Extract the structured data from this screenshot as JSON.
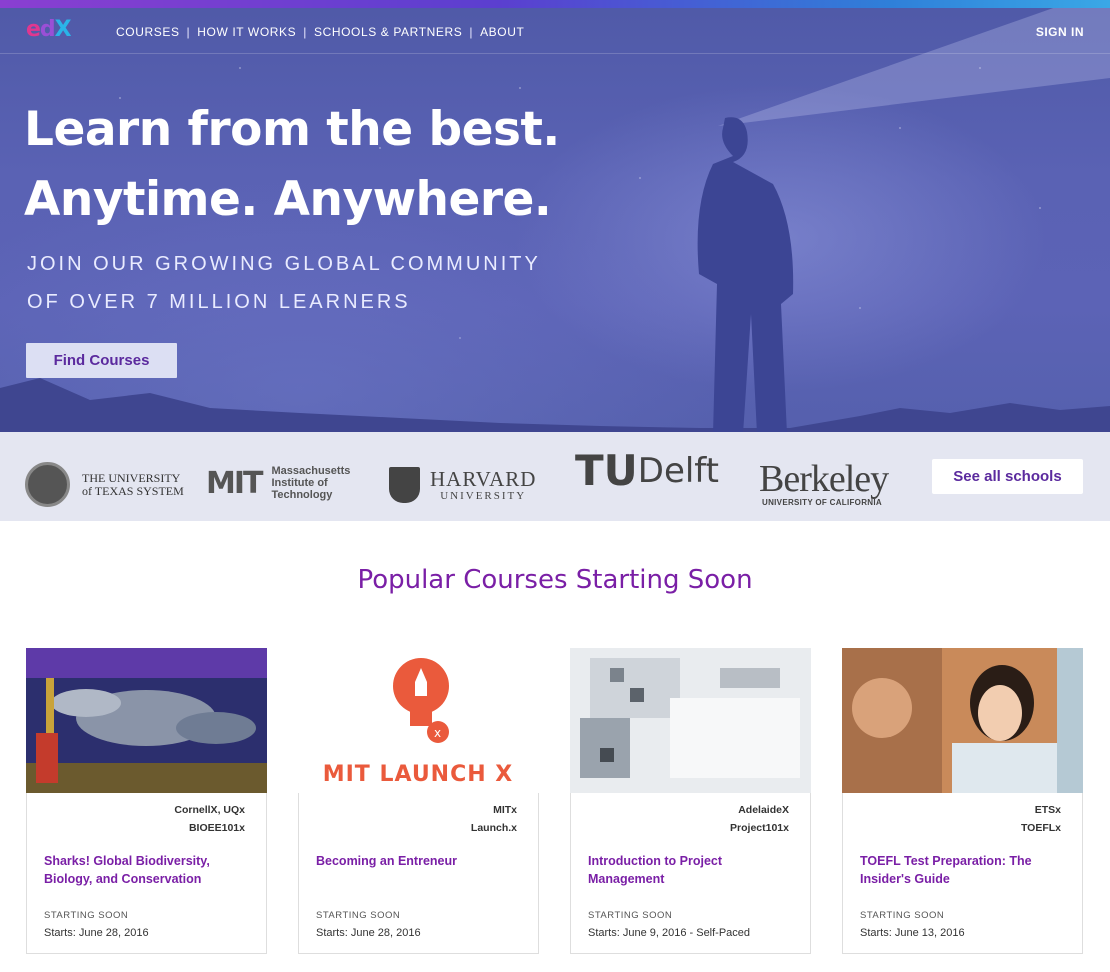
{
  "nav": {
    "logo": {
      "e": "e",
      "d": "d",
      "x": "X"
    },
    "links": [
      "COURSES",
      "HOW IT WORKS",
      "SCHOOLS & PARTNERS",
      "ABOUT"
    ],
    "separator": "|",
    "sign_in": "SIGN IN"
  },
  "hero": {
    "headline_1": "Learn from the best.",
    "headline_2": "Anytime. Anywhere.",
    "subline_1": "JOIN OUR GROWING GLOBAL COMMUNITY",
    "subline_2": "OF OVER 7 MILLION LEARNERS",
    "cta": "Find Courses"
  },
  "schools": {
    "ut": {
      "line1": "THE UNIVERSITY",
      "line2": "of TEXAS SYSTEM"
    },
    "mit": {
      "mark": "MIT",
      "line1": "Massachusetts",
      "line2": "Institute of",
      "line3": "Technology"
    },
    "harvard": {
      "big": "HARVARD",
      "small": "UNIVERSITY"
    },
    "tudelft": {
      "t": "TU",
      "rest": "Delft"
    },
    "berkeley": {
      "big": "Berkeley",
      "small": "UNIVERSITY OF CALIFORNIA"
    },
    "see_all": "See all schools"
  },
  "popular": {
    "title": "Popular Courses Starting Soon",
    "courses": [
      {
        "org": "CornellX, UQx",
        "code": "BIOEE101x",
        "title": "Sharks! Global Biodiversity, Biology, and Conservation",
        "status": "STARTING SOON",
        "starts": "Starts: June 28, 2016"
      },
      {
        "org": "MITx",
        "code": "Launch.x",
        "title": "Becoming an Entreneur",
        "status": "STARTING SOON",
        "starts": "Starts: June 28, 2016",
        "image_text": "MIT LAUNCH X"
      },
      {
        "org": "AdelaideX",
        "code": "Project101x",
        "title": "Introduction to Project Management",
        "status": "STARTING SOON",
        "starts": "Starts: June 9, 2016 - Self-Paced"
      },
      {
        "org": "ETSx",
        "code": "TOEFLx",
        "title": "TOEFL Test Preparation: The Insider's Guide",
        "status": "STARTING SOON",
        "starts": "Starts: June 13, 2016"
      }
    ]
  },
  "colors": {
    "brand_purple": "#7a1fa6",
    "button_text": "#5b2a9e",
    "hero_bg": "#5a62b4"
  }
}
